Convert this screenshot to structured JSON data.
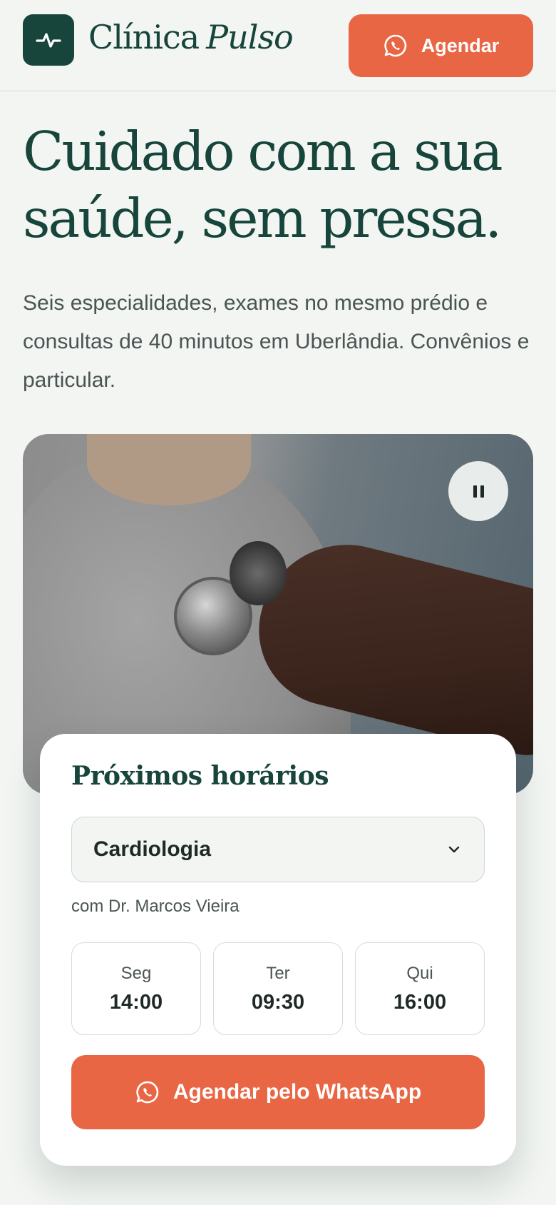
{
  "header": {
    "brand_main": "Clínica",
    "brand_accent": "Pulso",
    "cta_label": "Agendar",
    "logo_icon": "pulse-icon",
    "cta_icon": "whatsapp-icon"
  },
  "hero": {
    "title": "Cuidado com a sua saúde, sem pressa.",
    "subtitle": "Seis especialidades, exames no mesmo prédio e consultas de 40 minutos em Uberlândia. Convênios e particular."
  },
  "media": {
    "pause_icon": "pause-icon"
  },
  "booking": {
    "title": "Próximos horários",
    "specialty": "Cardiologia",
    "select_icon": "chevron-down-icon",
    "doctor": "com Dr. Marcos Vieira",
    "slots": [
      {
        "day": "Seg",
        "time": "14:00"
      },
      {
        "day": "Ter",
        "time": "09:30"
      },
      {
        "day": "Qui",
        "time": "16:00"
      }
    ],
    "cta_label": "Agendar pelo WhatsApp",
    "cta_icon": "whatsapp-icon"
  },
  "colors": {
    "brand_green": "#17453b",
    "accent_orange": "#e96644",
    "background": "#f2f5f2"
  }
}
